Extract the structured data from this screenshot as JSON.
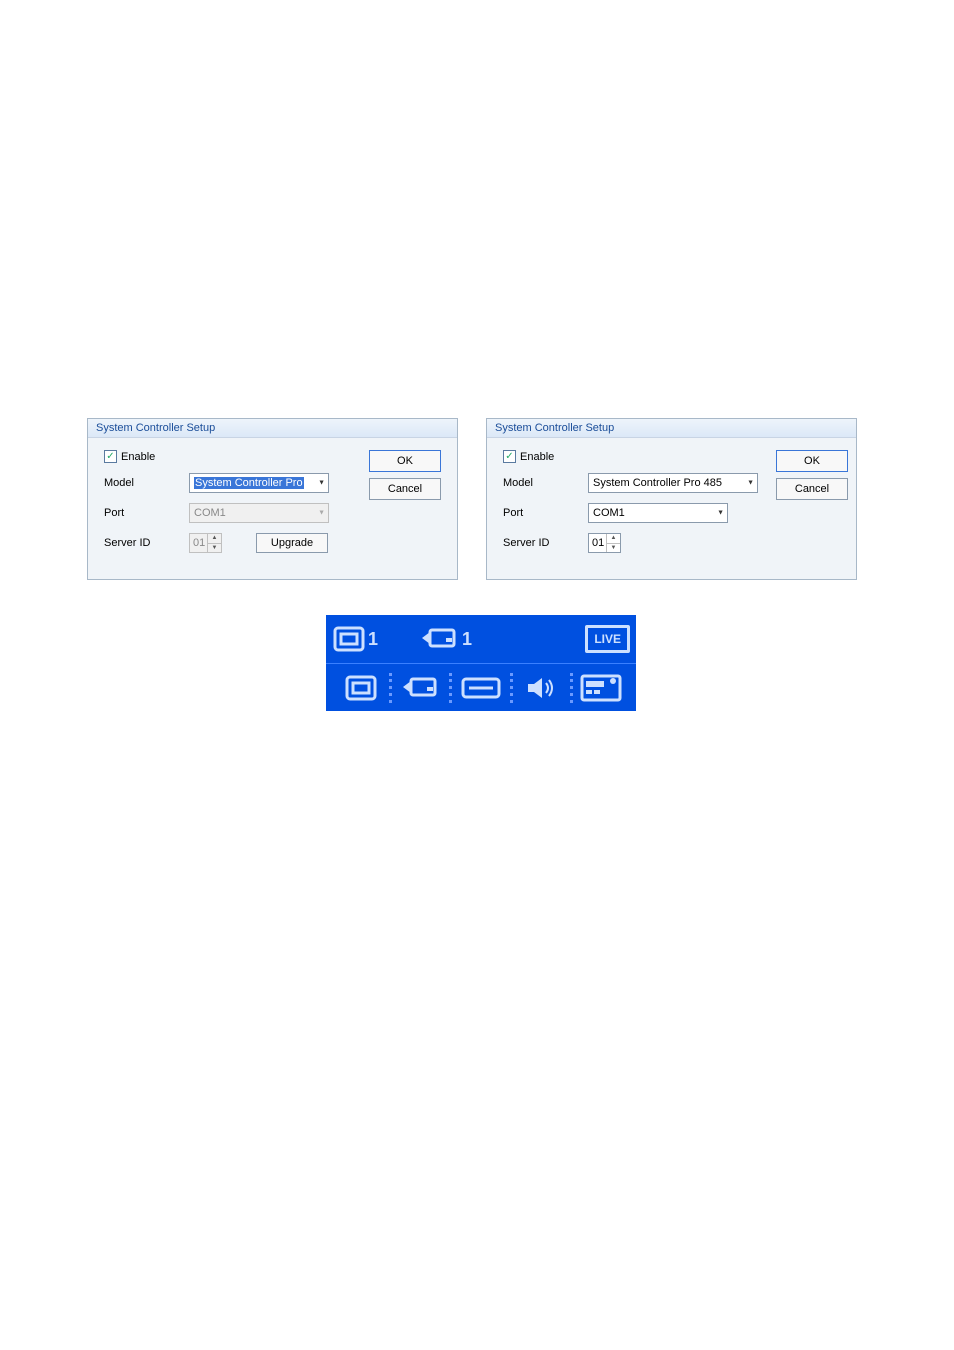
{
  "dialogs": {
    "left": {
      "title": "System Controller Setup",
      "enable_label": "Enable",
      "enable_checked": true,
      "model_label": "Model",
      "model_value": "System Controller Pro",
      "port_label": "Port",
      "port_value": "COM1",
      "port_enabled": false,
      "server_id_label": "Server ID",
      "server_id_value": "01",
      "server_id_enabled": false,
      "upgrade_label": "Upgrade",
      "ok_label": "OK",
      "cancel_label": "Cancel"
    },
    "right": {
      "title": "System Controller Setup",
      "enable_label": "Enable",
      "enable_checked": true,
      "model_label": "Model",
      "model_value": "System Controller Pro 485",
      "port_label": "Port",
      "port_value": "COM1",
      "port_enabled": true,
      "server_id_label": "Server ID",
      "server_id_value": "01",
      "server_id_enabled": true,
      "ok_label": "OK",
      "cancel_label": "Cancel"
    }
  },
  "lcd": {
    "monitor_num": "1",
    "camera_num": "1",
    "status": "LIVE"
  }
}
